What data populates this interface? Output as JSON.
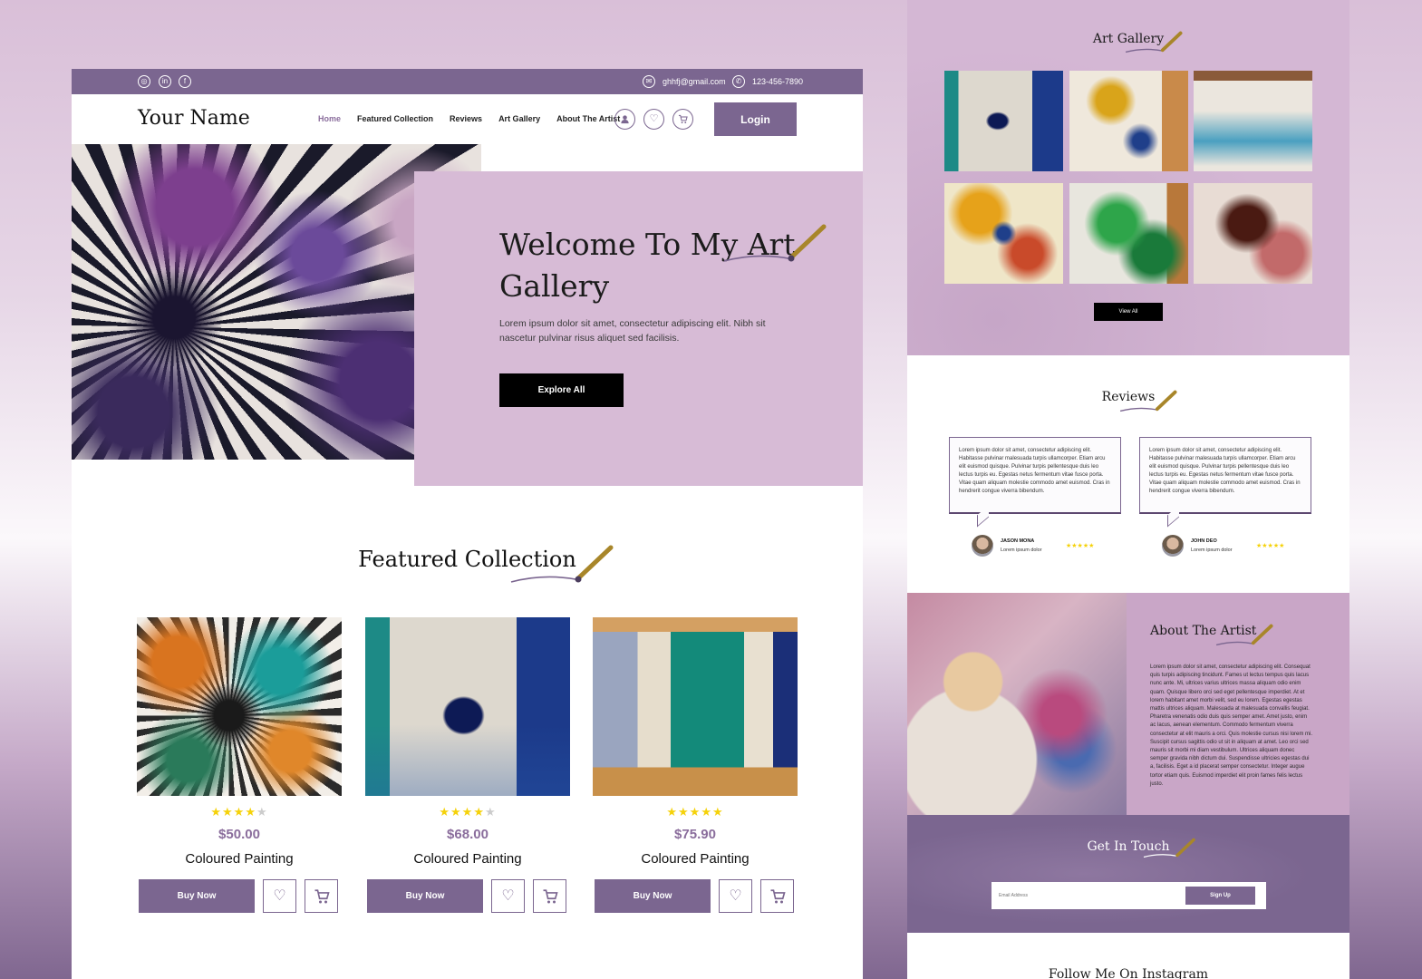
{
  "topbar": {
    "social_icons": [
      "instagram-icon",
      "linkedin-icon",
      "facebook-icon"
    ],
    "email": "ghhfj@gmail.com",
    "phone": "123-456-7890"
  },
  "nav": {
    "brand": "Your Name",
    "items": [
      "Home",
      "Featured Collection",
      "Reviews",
      "Art Gallery",
      "About The Artist"
    ],
    "active": "Home",
    "login_label": "Login",
    "icons": [
      "user-icon",
      "heart-icon",
      "cart-icon"
    ]
  },
  "hero": {
    "heading": "Welcome To My Art Gallery",
    "text": "Lorem ipsum dolor sit amet, consectetur adipiscing elit. Nibh sit nascetur pulvinar risus aliquet sed facilisis.",
    "cta": "Explore All"
  },
  "featured": {
    "title": "Featured Collection",
    "products": [
      {
        "name": "Coloured Painting",
        "price": "$50.00",
        "rating": 4,
        "buy_label": "Buy Now"
      },
      {
        "name": "Coloured Painting",
        "price": "$68.00",
        "rating": 4,
        "buy_label": "Buy Now"
      },
      {
        "name": "Coloured Painting",
        "price": "$75.90",
        "rating": 5,
        "buy_label": "Buy Now"
      }
    ]
  },
  "gallery": {
    "title": "Art Gallery",
    "view_all": "View All"
  },
  "reviews": {
    "title": "Reviews",
    "items": [
      {
        "text": "Lorem ipsum dolor sit amet, consectetur adipiscing elit. Habitasse pulvinar malesuada turpis ullamcorper. Etiam arcu elit euismod quisque. Pulvinar turpis pellentesque duis leo lectus turpis eu. Egestas netus fermentum vitae fusce porta. Vitae quam aliquam molestie commodo amet euismod. Cras in hendrerit congue viverra bibendum.",
        "name": "JASON MONA",
        "role": "Lorem ipsum dolor",
        "stars": "★★★★★"
      },
      {
        "text": "Lorem ipsum dolor sit amet, consectetur adipiscing elit. Habitasse pulvinar malesuada turpis ullamcorper. Etiam arcu elit euismod quisque. Pulvinar turpis pellentesque duis leo lectus turpis eu. Egestas netus fermentum vitae fusce porta. Vitae quam aliquam molestie commodo amet euismod. Cras in hendrerit congue viverra bibendum.",
        "name": "JOHN DEO",
        "role": "Lorem ipsum dolor",
        "stars": "★★★★★"
      }
    ]
  },
  "about": {
    "title": "About The Artist",
    "text": "Lorem ipsum dolor sit amet, consectetur adipiscing elit. Consequat quis turpis adipiscing tincidunt. Fames ut lectus tempus quis lacus nunc ante. Mi, ultrices varius ultrices massa aliquam odio enim quam. Quisque libero orci sed eget pellentesque imperdiet. At et lorem habitant amet morbi velit, sed eu lorem. Egestas egestas mattis ultrices aliquam. Malesuada at malesuada convallis feugiat. Pharetra venenatis odio duis quis semper amet. Amet justo, enim ac lacus, aenean elementum. Commodo fermentum viverra consectetur at elit mauris a orci. Quis molestie cursus nisi lorem mi. Suscipit cursus sagittis odio ut sit in aliquam at amet. Leo orci sed mauris sit morbi mi diam vestibulum. Ultrices aliquam donec semper gravida nibh dictum dui. Suspendisse ultricies egestas dui a, facilisis. Eget a id placerat semper consectetur. Integer augue tortor etiam quis. Euismod imperdiet elit proin fames felis lectus justo."
  },
  "touch": {
    "title": "Get In Touch",
    "email_placeholder": "Email Address",
    "signup": "Sign Up"
  },
  "instagram": {
    "title": "Follow Me On Instagram"
  },
  "colors": {
    "accent": "#7b6690",
    "hero_panel": "#d7bbd6",
    "price": "#8a6d9c",
    "star": "#f5d20a"
  }
}
